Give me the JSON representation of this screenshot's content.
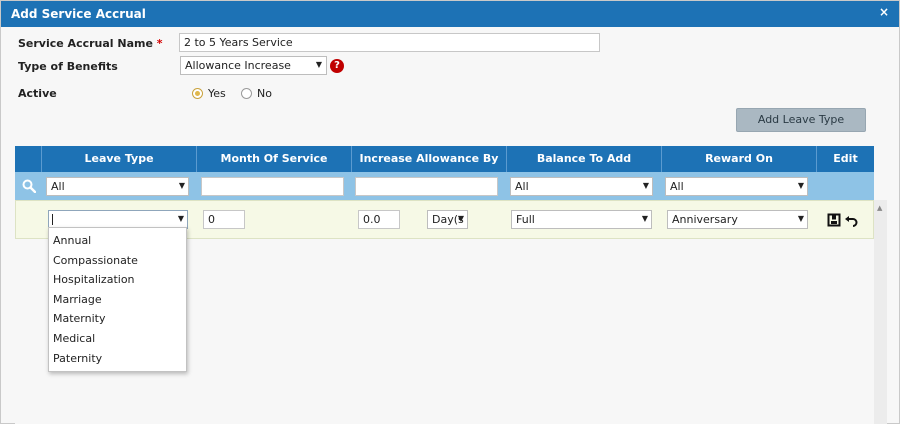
{
  "dialog": {
    "title": "Add Service Accrual",
    "close_label": "×"
  },
  "form": {
    "name_label": "Service Accrual Name",
    "name_required": "*",
    "name_value": "2 to 5 Years Service",
    "benefits_label": "Type of Benefits",
    "benefits_value": "Allowance Increase",
    "help_label": "?",
    "active_label": "Active",
    "active_yes": "Yes",
    "active_no": "No",
    "active_selected": "Yes"
  },
  "actions": {
    "add_leave_type": "Add Leave Type"
  },
  "grid": {
    "columns": [
      "Leave Type",
      "Month Of Service",
      "Increase Allowance By",
      "Balance To Add",
      "Reward On",
      "Edit"
    ],
    "filters": {
      "leave_type": "All",
      "month_of_service": "",
      "increase_allowance_by": "",
      "balance_to_add": "All",
      "reward_on": "All"
    },
    "edit_row": {
      "leave_type": "",
      "month_of_service": "0",
      "increase_value": "0.0",
      "increase_unit": "Day(s",
      "balance_to_add": "Full",
      "reward_on": "Anniversary"
    }
  },
  "leave_type_options": [
    "Annual",
    "Compassionate",
    "Hospitalization",
    "Marriage",
    "Maternity",
    "Medical",
    "Paternity"
  ],
  "colors": {
    "header_blue": "#1d72b5",
    "filter_blue": "#8ec3e6",
    "edit_row_bg": "#f6f9e6",
    "required_red": "#d40000",
    "help_red": "#c00000",
    "button_gray": "#aab8c2"
  },
  "icons": {
    "search": "search-icon",
    "save": "save-icon",
    "undo": "undo-icon",
    "help": "help-icon",
    "close": "close-icon",
    "dropdown": "chevron-down-icon"
  }
}
